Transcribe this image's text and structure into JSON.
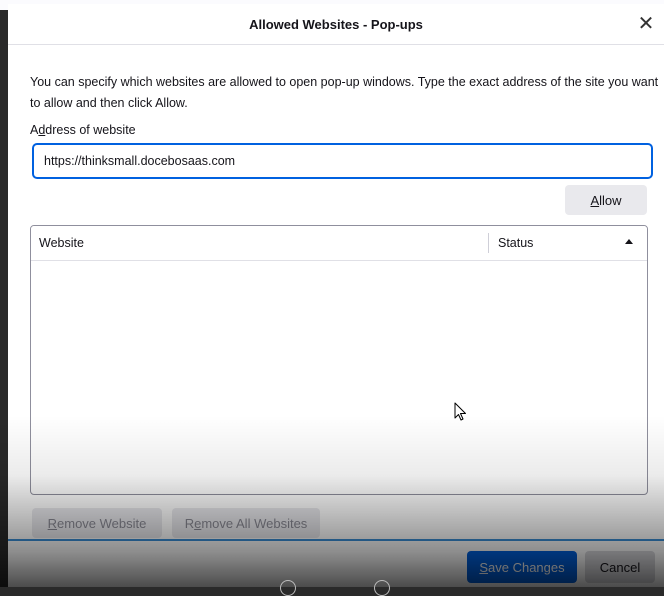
{
  "dialog": {
    "title": "Allowed Websites - Pop-ups",
    "close_symbol": "✕",
    "intro_text": "You can specify which websites are allowed to open pop-up windows. Type the exact address of the site you want to allow and then click Allow.",
    "address_label_pre": "A",
    "address_label_mnemonic": "d",
    "address_label_post": "dress of website",
    "address_value": "https://thinksmall.docebosaas.com",
    "allow_mnemonic": "A",
    "allow_rest": "llow"
  },
  "table": {
    "columns": [
      "Website",
      "Status"
    ],
    "sort_indicator": "ascending",
    "rows": []
  },
  "buttons": {
    "remove_website_mnemonic": "R",
    "remove_website_rest": "emove Website",
    "remove_all_pre": "R",
    "remove_all_mnemonic": "e",
    "remove_all_post": "move All Websites",
    "save_mnemonic": "S",
    "save_rest": "ave Changes",
    "cancel": "Cancel"
  },
  "colors": {
    "accent": "#0061e0",
    "button_bg": "#e9e9ed",
    "text": "#15141a"
  },
  "icons": {
    "close": "close-icon",
    "sort": "sort-ascending-icon",
    "cursor": "mouse-pointer-icon"
  }
}
